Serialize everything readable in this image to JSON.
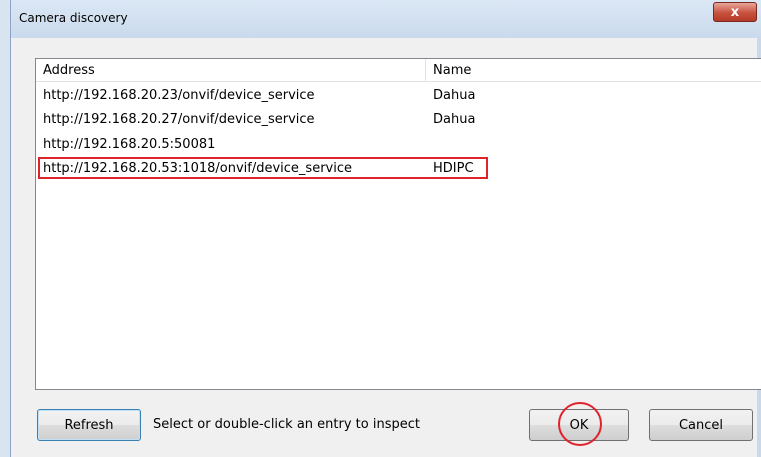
{
  "window": {
    "title": "Camera discovery",
    "close_glyph": "x"
  },
  "list": {
    "columns": [
      "Address",
      "Name"
    ],
    "rows": [
      {
        "address": "http://192.168.20.23/onvif/device_service",
        "name": "Dahua"
      },
      {
        "address": "http://192.168.20.27/onvif/device_service",
        "name": "Dahua"
      },
      {
        "address": "http://192.168.20.5:50081",
        "name": ""
      },
      {
        "address": "http://192.168.20.53:1018/onvif/device_service",
        "name": "HDIPC"
      }
    ]
  },
  "footer": {
    "refresh_label": "Refresh",
    "hint": "Select or double-click an entry to inspect",
    "ok_label": "OK",
    "cancel_label": "Cancel"
  },
  "annotations": {
    "highlight_color": "#e0222b"
  }
}
